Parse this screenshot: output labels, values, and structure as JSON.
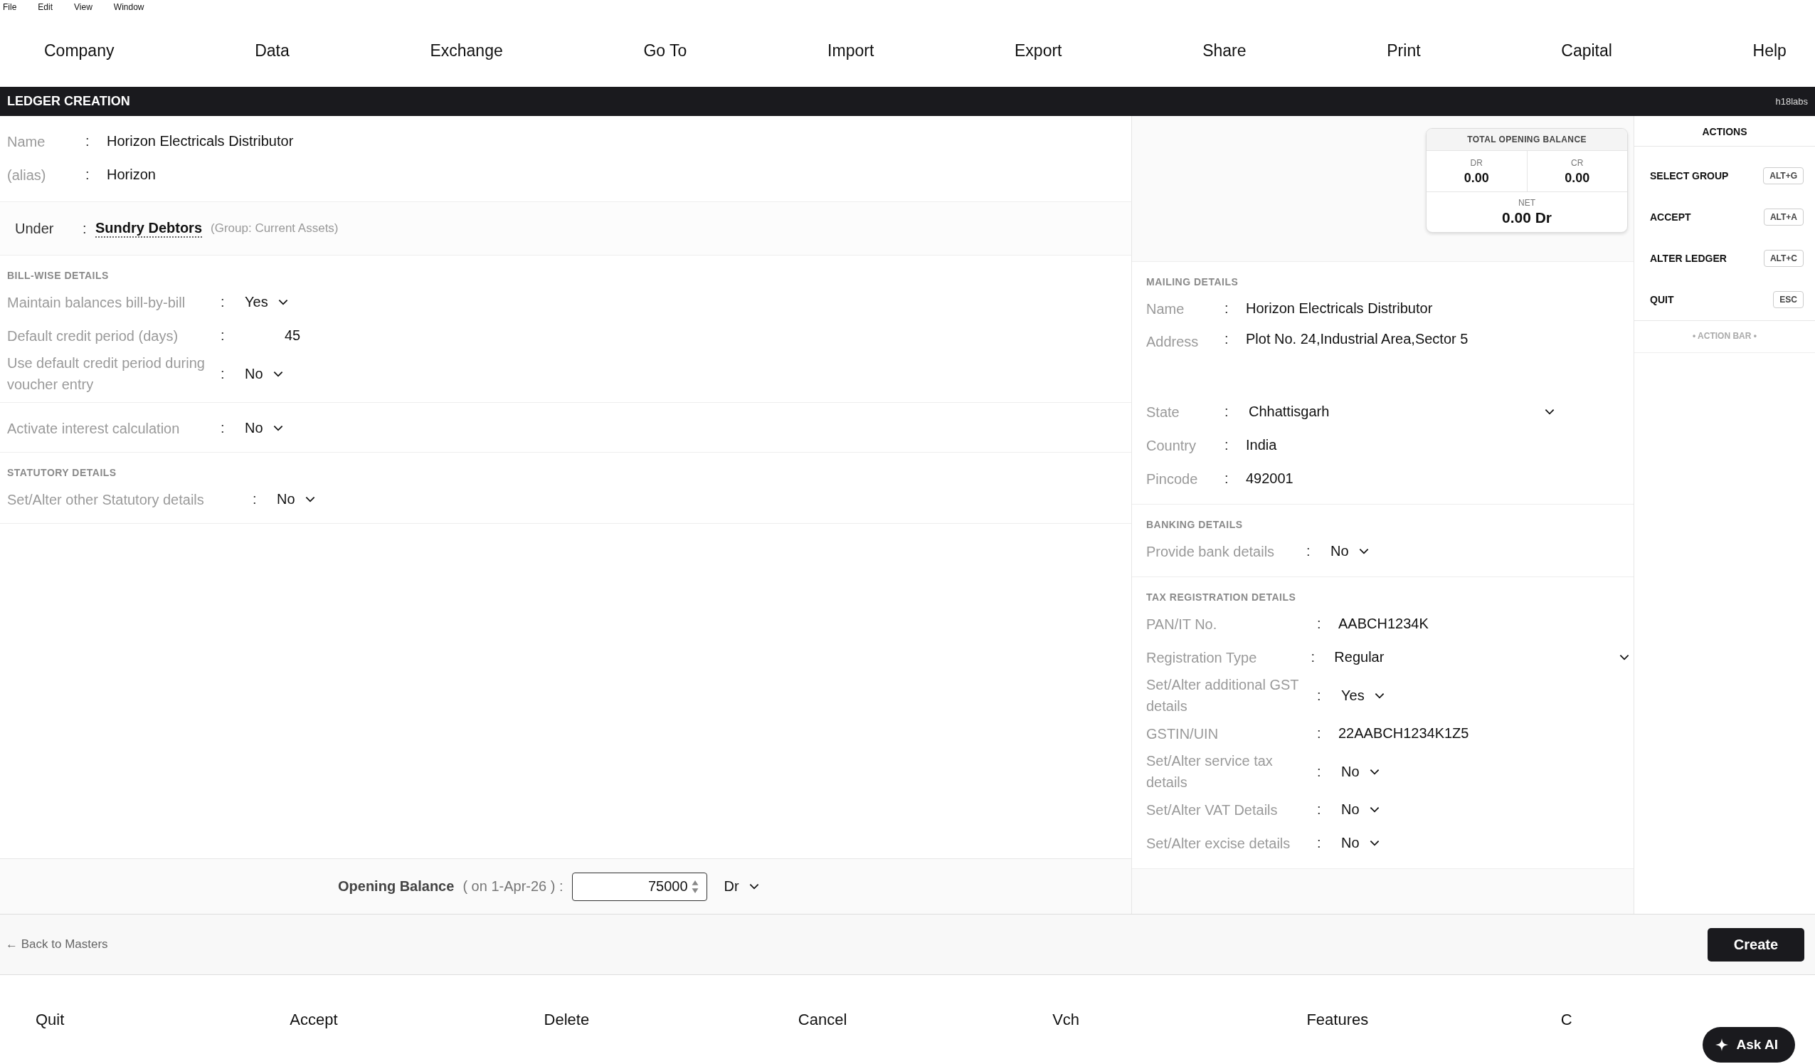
{
  "menubar": [
    "File",
    "Edit",
    "View",
    "Window"
  ],
  "top_nav": [
    "Company",
    "Data",
    "Exchange",
    "Go To",
    "Import",
    "Export",
    "Share",
    "Print",
    "Capital",
    "Help"
  ],
  "title_bar": {
    "title": "LEDGER CREATION",
    "brand": "h18labs"
  },
  "basic_fields": [
    {
      "label": "Name",
      "sep": ":",
      "value": "Horizon Electricals Distributor"
    },
    {
      "label": "(alias)",
      "sep": ":",
      "value": "Horizon"
    }
  ],
  "under": {
    "label": "Under",
    "sep": ":",
    "value": "Sundry Debtors",
    "hint": "(Group: Current Assets)"
  },
  "left_sections": [
    {
      "heading": "BILL-WISE DETAILS",
      "fields": [
        {
          "label": "Maintain balances bill-by-bill",
          "sep": ":",
          "value": "Yes",
          "kind": "dropdown"
        },
        {
          "label": "Default credit period (days)",
          "sep": ":",
          "value": "45",
          "kind": "number"
        },
        {
          "label": "Use default credit period during voucher entry",
          "sep": ":",
          "value": "No",
          "kind": "dropdown"
        }
      ]
    },
    {
      "fields": [
        {
          "label": "Activate interest calculation",
          "sep": ":",
          "value": "No",
          "kind": "dropdown"
        }
      ]
    },
    {
      "heading": "STATUTORY DETAILS",
      "fields": [
        {
          "label": "Set/Alter other Statutory details",
          "sep": ":",
          "value": "No",
          "kind": "dropdown"
        }
      ]
    }
  ],
  "opening_balance": {
    "label": "Opening Balance",
    "note": "( on 1-Apr-26 ) :",
    "value": "75000",
    "side": "Dr"
  },
  "balance_card": {
    "title": "TOTAL OPENING BALANCE",
    "dr_label": "DR",
    "dr_value": "0.00",
    "cr_label": "CR",
    "cr_value": "0.00",
    "net_label": "NET",
    "net_value": "0.00 Dr"
  },
  "right_sections": [
    {
      "heading": "MAILING DETAILS",
      "fields": [
        {
          "label": "Name",
          "sep": ":",
          "value": "Horizon Electricals Distributor",
          "kind": "text"
        },
        {
          "label": "Address",
          "sep": ":",
          "value": "Plot No. 24,Industrial Area,Sector 5",
          "kind": "address"
        },
        {
          "label": "State",
          "sep": ":",
          "value": "Chhattisgarh",
          "kind": "wide_dropdown"
        },
        {
          "label": "Country",
          "sep": ":",
          "value": "India",
          "kind": "text"
        },
        {
          "label": "Pincode",
          "sep": ":",
          "value": "492001",
          "kind": "text"
        }
      ]
    },
    {
      "heading": "BANKING DETAILS",
      "fields": [
        {
          "label": "Provide bank details",
          "sep": ":",
          "value": "No",
          "kind": "dropdown"
        }
      ]
    },
    {
      "heading": "TAX REGISTRATION DETAILS",
      "fields": [
        {
          "label": "PAN/IT No.",
          "sep": ":",
          "value": "AABCH1234K",
          "kind": "text"
        },
        {
          "label": "Registration Type",
          "sep": ":",
          "value": "Regular",
          "kind": "wide_dropdown"
        },
        {
          "label": "Set/Alter additional GST details",
          "sep": ":",
          "value": "Yes",
          "kind": "dropdown"
        },
        {
          "label": "GSTIN/UIN",
          "sep": ":",
          "value": "22AABCH1234K1Z5",
          "kind": "text"
        },
        {
          "label": "Set/Alter service tax details",
          "sep": ":",
          "value": "No",
          "kind": "dropdown"
        },
        {
          "label": "Set/Alter VAT Details",
          "sep": ":",
          "value": "No",
          "kind": "dropdown"
        },
        {
          "label": "Set/Alter excise details",
          "sep": ":",
          "value": "No",
          "kind": "dropdown"
        }
      ]
    }
  ],
  "actions": {
    "heading": "ACTIONS",
    "items": [
      {
        "label": "SELECT GROUP",
        "key": "ALT+G"
      },
      {
        "label": "ACCEPT",
        "key": "ALT+A"
      },
      {
        "label": "ALTER LEDGER",
        "key": "ALT+C"
      },
      {
        "label": "QUIT",
        "key": "ESC"
      }
    ],
    "footer": "• ACTION BAR •"
  },
  "back_link": "← Back to Masters",
  "create_button": "Create",
  "bottom_nav": [
    "Quit",
    "Accept",
    "Delete",
    "Cancel",
    "Vch",
    "Features",
    "C"
  ],
  "ask_ai": "Ask AI"
}
